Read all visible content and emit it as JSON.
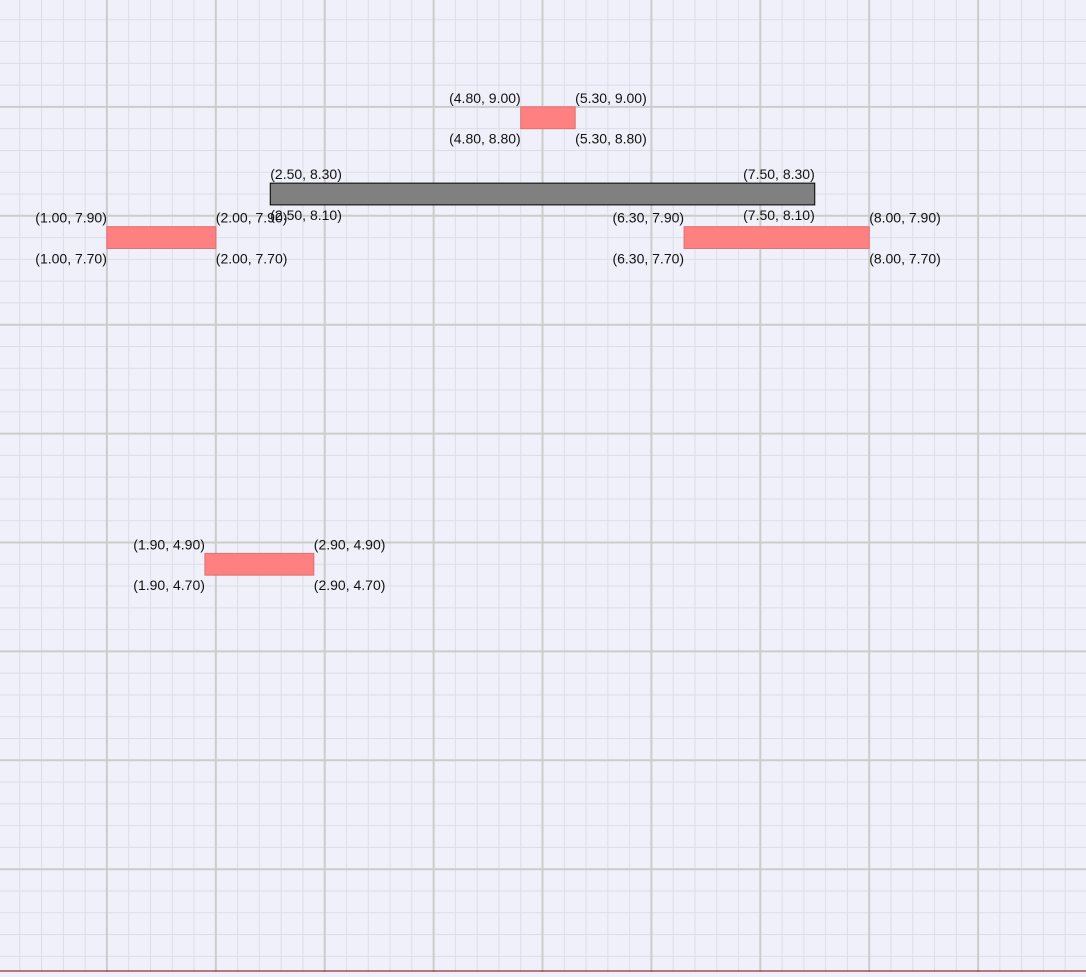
{
  "colors": {
    "background": "#f0f0fa",
    "grid_major": "#cccccc",
    "grid_minor": "#dddde8",
    "target_fill": "#ff8080",
    "target_stroke": "#e07070",
    "agent_fill": "#808080",
    "agent_stroke": "#000000",
    "bottom_line": "#800000"
  },
  "grid": {
    "major_step": 1.0,
    "minor_step": 0.2
  },
  "agent_block": {
    "kind": "agent",
    "x1": 2.5,
    "x2": 7.5,
    "y1": 8.1,
    "y2": 8.3,
    "corner_labels": {
      "top_left": "(2.50, 8.30)",
      "top_right": "(7.50, 8.30)",
      "bottom_left": "(2.50, 8.10)",
      "bottom_right": "(7.50, 8.10)"
    }
  },
  "target_blocks": [
    {
      "kind": "target",
      "x1": 4.8,
      "x2": 5.3,
      "y1": 8.8,
      "y2": 9.0,
      "corner_labels": {
        "top_left": "(4.80, 9.00)",
        "top_right": "(5.30, 9.00)",
        "bottom_left": "(4.80, 8.80)",
        "bottom_right": "(5.30, 8.80)"
      }
    },
    {
      "kind": "target",
      "x1": 1.0,
      "x2": 2.0,
      "y1": 7.7,
      "y2": 7.9,
      "corner_labels": {
        "top_left": "(1.00, 7.90)",
        "top_right": "(2.00, 7.90)",
        "bottom_left": "(1.00, 7.70)",
        "bottom_right": "(2.00, 7.70)"
      }
    },
    {
      "kind": "target",
      "x1": 6.3,
      "x2": 8.0,
      "y1": 7.7,
      "y2": 7.9,
      "corner_labels": {
        "top_left": "(6.30, 7.90)",
        "top_right": "(8.00, 7.90)",
        "bottom_left": "(6.30, 7.70)",
        "bottom_right": "(8.00, 7.70)"
      }
    },
    {
      "kind": "target",
      "x1": 1.9,
      "x2": 2.9,
      "y1": 4.7,
      "y2": 4.9,
      "corner_labels": {
        "top_left": "(1.90, 4.90)",
        "top_right": "(2.90, 4.90)",
        "bottom_left": "(1.90, 4.70)",
        "bottom_right": "(2.90, 4.70)"
      }
    }
  ]
}
